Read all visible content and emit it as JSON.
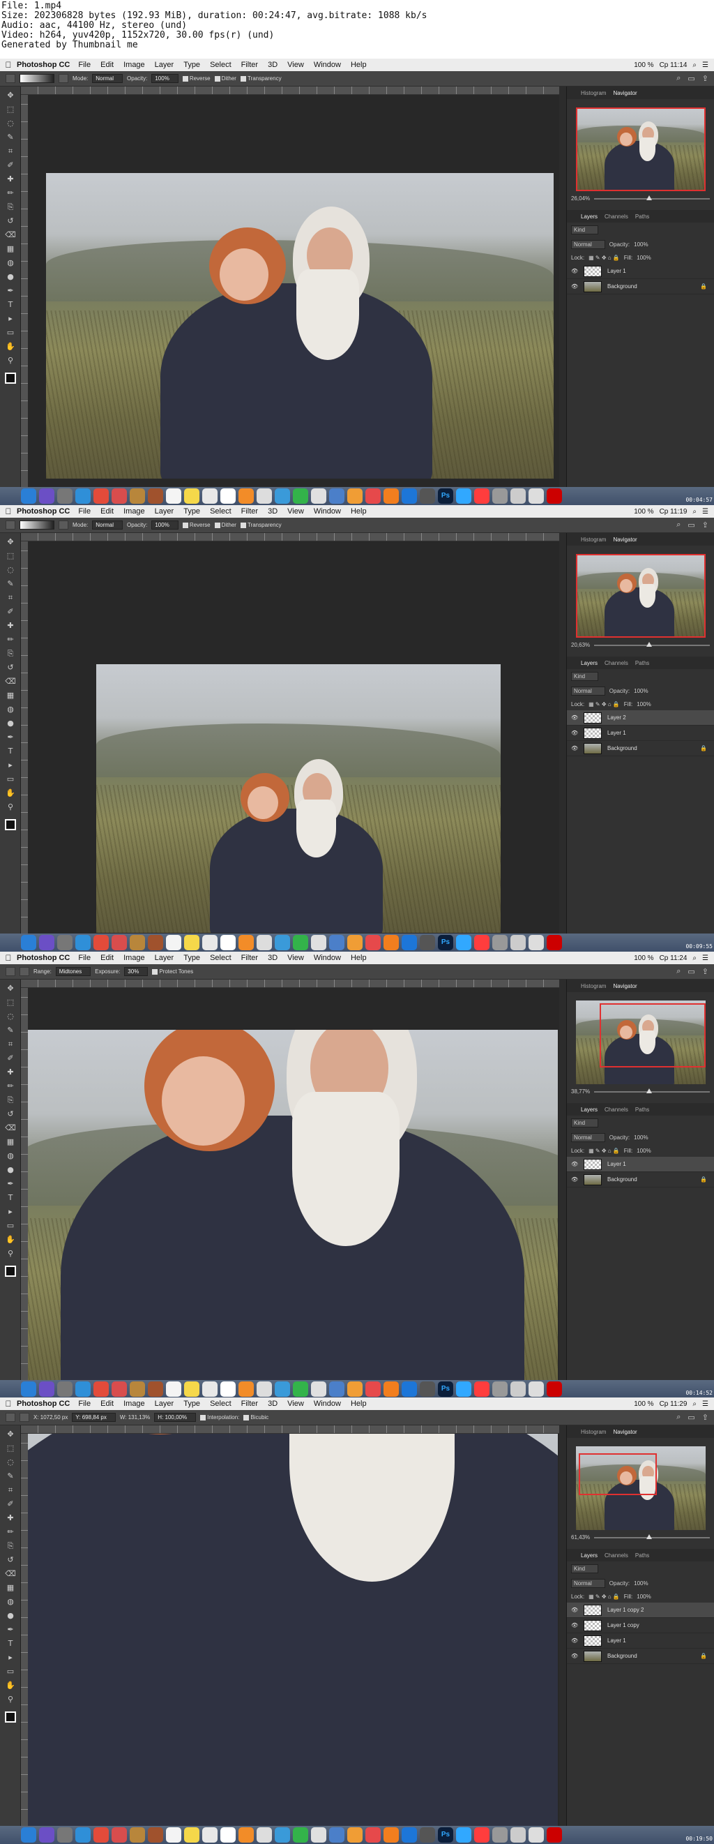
{
  "header": {
    "lines": [
      "File: 1.mp4",
      "Size: 202306828 bytes (192.93 MiB), duration: 00:24:47, avg.bitrate: 1088 kb/s",
      "Audio: aac, 44100 Hz, stereo (und)",
      "Video: h264, yuv420p, 1152x720, 30.00 fps(r) (und)",
      "Generated by Thumbnail me"
    ]
  },
  "menu": {
    "apple": "",
    "app": "Photoshop CC",
    "items": [
      "File",
      "Edit",
      "Image",
      "Layer",
      "Type",
      "Select",
      "Filter",
      "3D",
      "View",
      "Window",
      "Help"
    ]
  },
  "frames": [
    {
      "clock": "Ср 11:14",
      "battery": "100 %",
      "options": {
        "mode_label": "Mode:",
        "mode": "Normal",
        "opacity_label": "Opacity:",
        "opacity": "100%",
        "chk1": "Reverse",
        "chk2": "Dither",
        "chk3": "Transparency"
      },
      "zoom": "26,04%",
      "layers": [
        {
          "name": "Layer 1",
          "sel": false
        },
        {
          "name": "Background",
          "sel": false
        }
      ],
      "timestamp": "00:04:57"
    },
    {
      "clock": "Ср 11:19",
      "battery": "100 %",
      "options": {
        "mode_label": "Mode:",
        "mode": "Normal",
        "opacity_label": "Opacity:",
        "opacity": "100%",
        "chk1": "Reverse",
        "chk2": "Dither",
        "chk3": "Transparency"
      },
      "zoom": "20,63%",
      "layers": [
        {
          "name": "Layer 2",
          "sel": true
        },
        {
          "name": "Layer 1",
          "sel": false
        },
        {
          "name": "Background",
          "sel": false
        }
      ],
      "timestamp": "00:09:55"
    },
    {
      "clock": "Ср 11:24",
      "battery": "100 %",
      "options": {
        "mode_label": "Range:",
        "mode": "Midtones",
        "opacity_label": "Exposure:",
        "opacity": "30%",
        "chk1": "Protect Tones",
        "chk2": "",
        "chk3": ""
      },
      "zoom": "38,77%",
      "layers": [
        {
          "name": "Layer 1",
          "sel": true
        },
        {
          "name": "Background",
          "sel": false
        }
      ],
      "timestamp": "00:14:52"
    },
    {
      "clock": "Ср 11:29",
      "battery": "100 %",
      "options": {
        "mode_label": "X: 1072,50 px",
        "mode": "Y: 698,84 px",
        "opacity_label": "W: 131,13%",
        "opacity": "H: 100,00%",
        "chk1": "Interpolation:",
        "chk2": "Bicubic",
        "chk3": ""
      },
      "zoom": "61,43%",
      "layers": [
        {
          "name": "Layer 1 copy 2",
          "sel": true
        },
        {
          "name": "Layer 1 copy",
          "sel": false
        },
        {
          "name": "Layer 1",
          "sel": false
        },
        {
          "name": "Background",
          "sel": false
        }
      ],
      "timestamp": "00:19:50"
    }
  ],
  "panel": {
    "tab_histogram": "Histogram",
    "tab_navigator": "Navigator",
    "tab_layers": "Layers",
    "tab_channels": "Channels",
    "tab_paths": "Paths",
    "kind": "Kind",
    "blend": "Normal",
    "opacity_label": "Opacity:",
    "opacity": "100%",
    "lock_label": "Lock:",
    "fill_label": "Fill:",
    "fill": "100%"
  },
  "colors": {
    "accent": "#e03030",
    "photoshop": "#31a8ff"
  }
}
